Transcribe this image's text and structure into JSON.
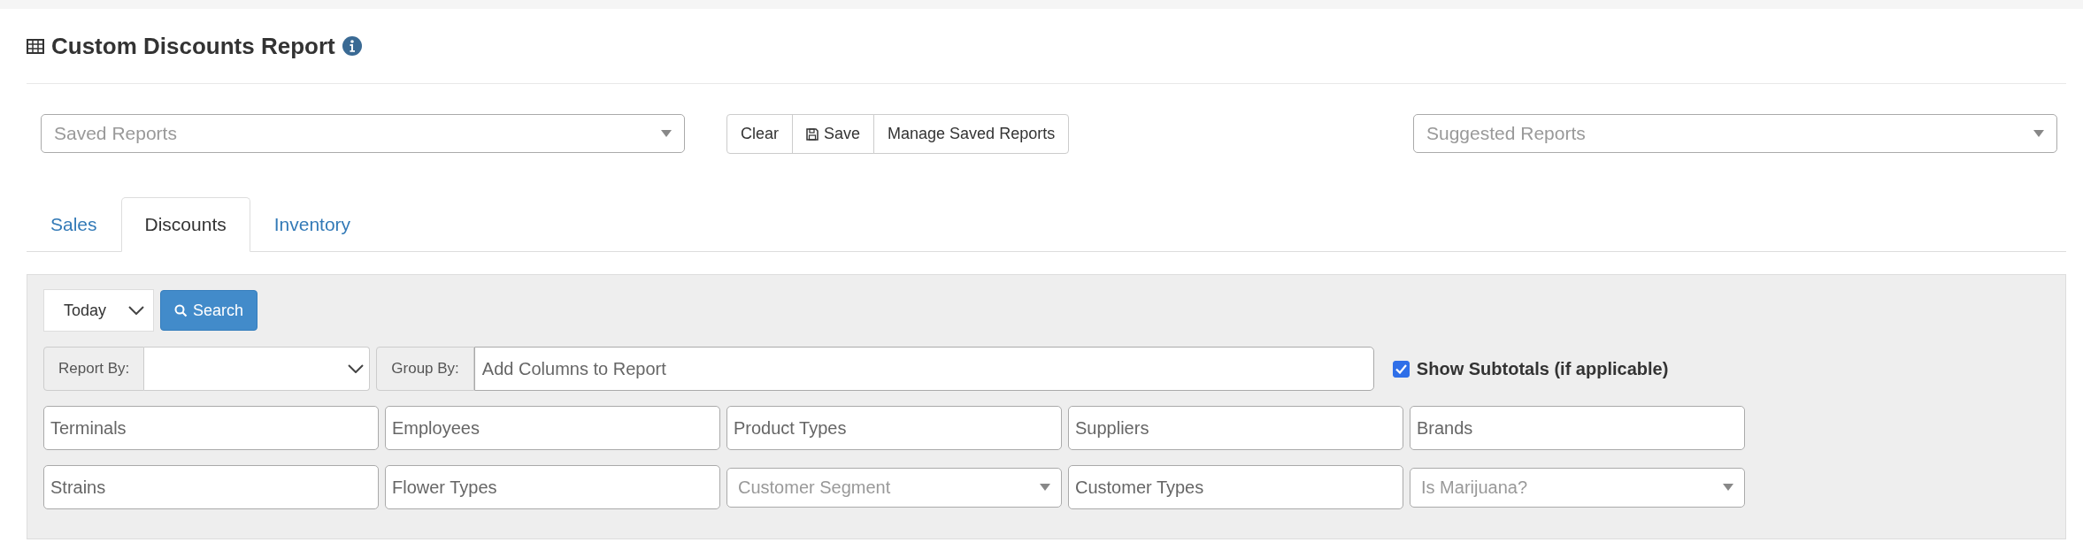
{
  "header": {
    "title": "Custom Discounts Report"
  },
  "saved_reports": {
    "placeholder": "Saved Reports"
  },
  "buttons": [
    {
      "label": "Clear",
      "kind": "text"
    },
    {
      "label": "Save",
      "kind": "save"
    },
    {
      "label": "Manage Saved Reports",
      "kind": "text"
    }
  ],
  "suggested_reports": {
    "placeholder": "Suggested Reports"
  },
  "tabs": [
    {
      "label": "Sales",
      "selected": false
    },
    {
      "label": "Discounts",
      "selected": true
    },
    {
      "label": "Inventory",
      "selected": false
    }
  ],
  "filters": {
    "period": {
      "value": "Today"
    },
    "search_button": "Search",
    "report_by": {
      "label": "Report By:"
    },
    "group_by": {
      "label": "Group By:",
      "placeholder": "Add Columns to Report"
    },
    "show_subtotals": {
      "label": "Show Subtotals (if applicable)",
      "checked": true
    },
    "rows": [
      [
        {
          "placeholder": "Terminals",
          "kind": "multi"
        },
        {
          "placeholder": "Employees",
          "kind": "multi"
        },
        {
          "placeholder": "Product Types",
          "kind": "multi"
        },
        {
          "placeholder": "Suppliers",
          "kind": "multi"
        },
        {
          "placeholder": "Brands",
          "kind": "multi"
        }
      ],
      [
        {
          "placeholder": "Strains",
          "kind": "multi"
        },
        {
          "placeholder": "Flower Types",
          "kind": "multi"
        },
        {
          "placeholder": "Customer Segment",
          "kind": "select"
        },
        {
          "placeholder": "Customer Types",
          "kind": "multi"
        },
        {
          "placeholder": "Is Marijuana?",
          "kind": "select"
        }
      ]
    ]
  }
}
